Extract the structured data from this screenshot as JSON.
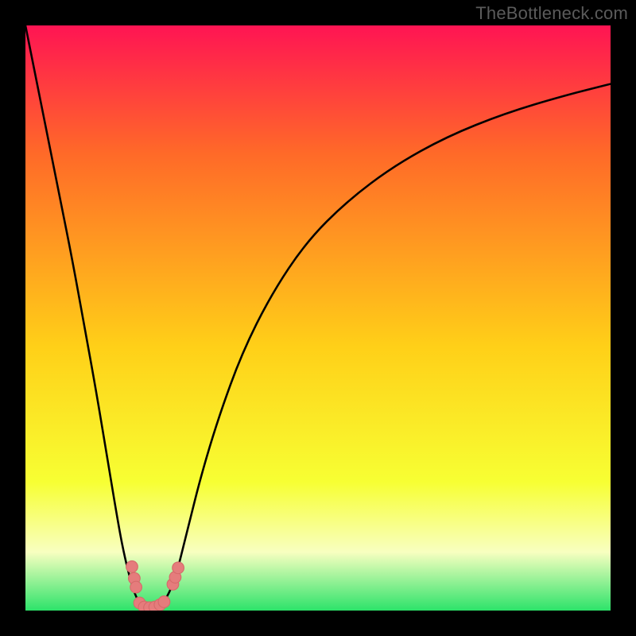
{
  "watermark": "TheBottleneck.com",
  "colors": {
    "background": "#000000",
    "gradient_top": "#FF1453",
    "gradient_upper_mid": "#FF6A28",
    "gradient_mid": "#FFD018",
    "gradient_lower_mid": "#F7FF33",
    "gradient_pale": "#F8FFC0",
    "gradient_bottom": "#2DE36A",
    "curve": "#000000",
    "marker_fill": "#E57C7C",
    "marker_stroke": "#D66A6A"
  },
  "chart_data": {
    "type": "line",
    "title": "",
    "xlabel": "",
    "ylabel": "",
    "xlim": [
      0,
      100
    ],
    "ylim": [
      0,
      100
    ],
    "series": [
      {
        "name": "bottleneck-curve",
        "x": [
          0,
          2,
          4,
          6,
          8,
          10,
          12,
          14,
          16,
          17,
          18,
          19,
          20,
          21,
          22,
          23,
          24,
          25,
          26,
          27,
          28,
          30,
          33,
          37,
          42,
          48,
          55,
          63,
          72,
          82,
          92,
          100
        ],
        "y": [
          100,
          90,
          80,
          70,
          60,
          49,
          38,
          26,
          14,
          9,
          5,
          2,
          0.8,
          0.3,
          0.3,
          0.8,
          2,
          4,
          7,
          11,
          15,
          23,
          33,
          44,
          54,
          63,
          70,
          76,
          81,
          85,
          88,
          90
        ]
      }
    ],
    "markers": [
      {
        "x": 18.2,
        "y": 7.5,
        "r": 1.0
      },
      {
        "x": 18.6,
        "y": 5.5,
        "r": 1.0
      },
      {
        "x": 18.9,
        "y": 4.0,
        "r": 1.0
      },
      {
        "x": 19.5,
        "y": 1.3,
        "r": 1.0
      },
      {
        "x": 20.3,
        "y": 0.6,
        "r": 1.0
      },
      {
        "x": 21.2,
        "y": 0.5,
        "r": 1.0
      },
      {
        "x": 22.1,
        "y": 0.6,
        "r": 1.0
      },
      {
        "x": 23.0,
        "y": 1.0,
        "r": 1.0
      },
      {
        "x": 23.7,
        "y": 1.5,
        "r": 1.0
      },
      {
        "x": 25.2,
        "y": 4.5,
        "r": 1.0
      },
      {
        "x": 25.6,
        "y": 5.7,
        "r": 1.0
      },
      {
        "x": 26.1,
        "y": 7.3,
        "r": 1.0
      }
    ],
    "gradient_stops": [
      {
        "offset": 0,
        "key": "gradient_top"
      },
      {
        "offset": 22,
        "key": "gradient_upper_mid"
      },
      {
        "offset": 55,
        "key": "gradient_mid"
      },
      {
        "offset": 78,
        "key": "gradient_lower_mid"
      },
      {
        "offset": 90,
        "key": "gradient_pale"
      },
      {
        "offset": 100,
        "key": "gradient_bottom"
      }
    ]
  }
}
